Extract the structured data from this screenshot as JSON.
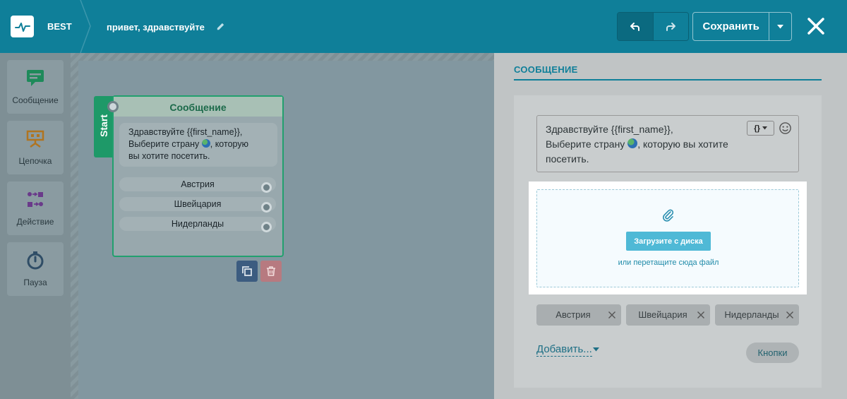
{
  "header": {
    "brand": "BEST",
    "flow_title": "привет, здравствуйте",
    "save_label": "Сохранить"
  },
  "tools": [
    {
      "label": "Сообщение",
      "icon": "message-icon"
    },
    {
      "label": "Цепочка",
      "icon": "chain-icon"
    },
    {
      "label": "Действие",
      "icon": "action-icon"
    },
    {
      "label": "Пауза",
      "icon": "timer-icon"
    }
  ],
  "canvas": {
    "start_label": "Start",
    "node": {
      "title": "Сообщение",
      "text_line1": "Здравствуйте  {{first_name}},",
      "text_line2_a": "Выберите страну ",
      "text_line2_b": ", которую",
      "text_line3": "вы хотите посетить.",
      "buttons": [
        "Австрия",
        "Швейцария",
        "Нидерланды"
      ]
    }
  },
  "panel": {
    "title": "СООБЩЕНИЕ",
    "message_line1": "Здравствуйте  {{first_name}},",
    "message_line2_a": "Выберите страну ",
    "message_line2_b": ", которую вы хотите",
    "message_line3": "посетить.",
    "var_button": "{}",
    "upload_button": "Загрузите с диска",
    "upload_hint": "или перетащите сюда файл",
    "tags": [
      "Австрия",
      "Швейцария",
      "Нидерланды"
    ],
    "add_label": "Добавить...",
    "buttons_label": "Кнопки"
  },
  "colors": {
    "header": "#0f7f99",
    "node_border": "#22a06e",
    "upload_button": "#4fb9d6"
  }
}
